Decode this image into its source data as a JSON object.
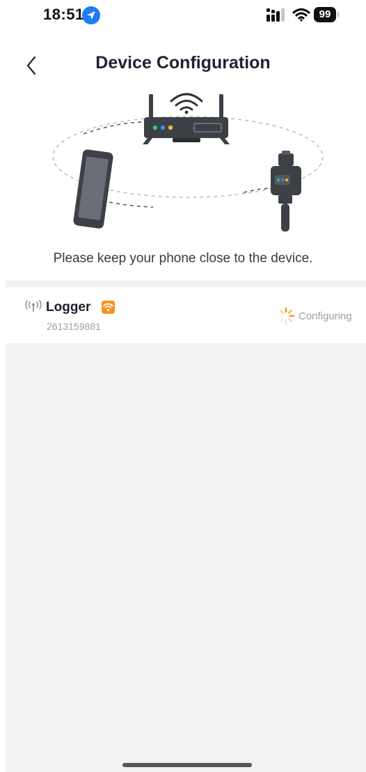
{
  "status_bar": {
    "time": "18:51",
    "battery": "99"
  },
  "nav": {
    "title": "Device Configuration"
  },
  "hint": "Please keep your phone close to the device.",
  "device": {
    "name": "Logger",
    "serial": "2613159881",
    "status": "Configuring",
    "icons": {
      "left": "antenna-icon",
      "badge": "wifi-icon",
      "status": "loading-spinner-icon"
    }
  },
  "colors": {
    "accent_orange": "#f7941d",
    "location_blue": "#1f7cf5",
    "background_gray": "#f2f2f2"
  }
}
